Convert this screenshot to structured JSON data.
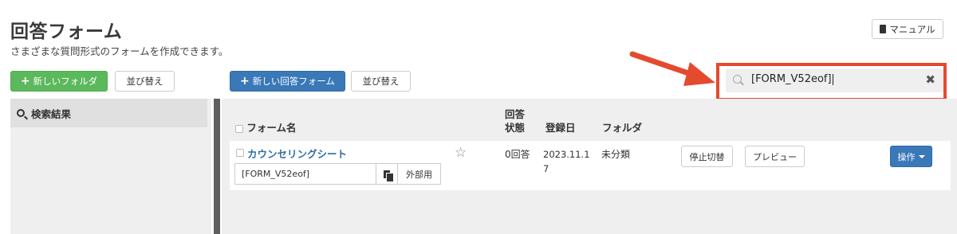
{
  "header": {
    "title": "回答フォーム",
    "description": "さまざまな質問形式のフォームを作成できます。",
    "manual_label": "マニュアル"
  },
  "toolbar": {
    "new_folder_label": "新しいフォルダ",
    "sort_folders_label": "並び替え",
    "new_form_label": "新しい回答フォーム",
    "sort_forms_label": "並び替え"
  },
  "search": {
    "value": "[FORM_V52eof]"
  },
  "sidebar": {
    "items": [
      {
        "label": "検索結果"
      }
    ]
  },
  "table": {
    "columns": {
      "name": "フォーム名",
      "status_line1": "回答",
      "status_line2": "状態",
      "registered": "登録日",
      "folder": "フォルダ"
    },
    "rows": [
      {
        "name": "カウンセリングシート",
        "form_id": "[FORM_V52eof]",
        "external_label": "外部用",
        "responses": "0回答",
        "date_line1": "2023.11.1",
        "date_line2": "7",
        "folder": "未分類",
        "stop_toggle_label": "停止切替",
        "preview_label": "プレビュー",
        "actions_label": "操作"
      }
    ]
  },
  "colors": {
    "highlight_red": "#e44a2e",
    "primary_blue": "#3a78b8",
    "success_green": "#5cb85c"
  }
}
